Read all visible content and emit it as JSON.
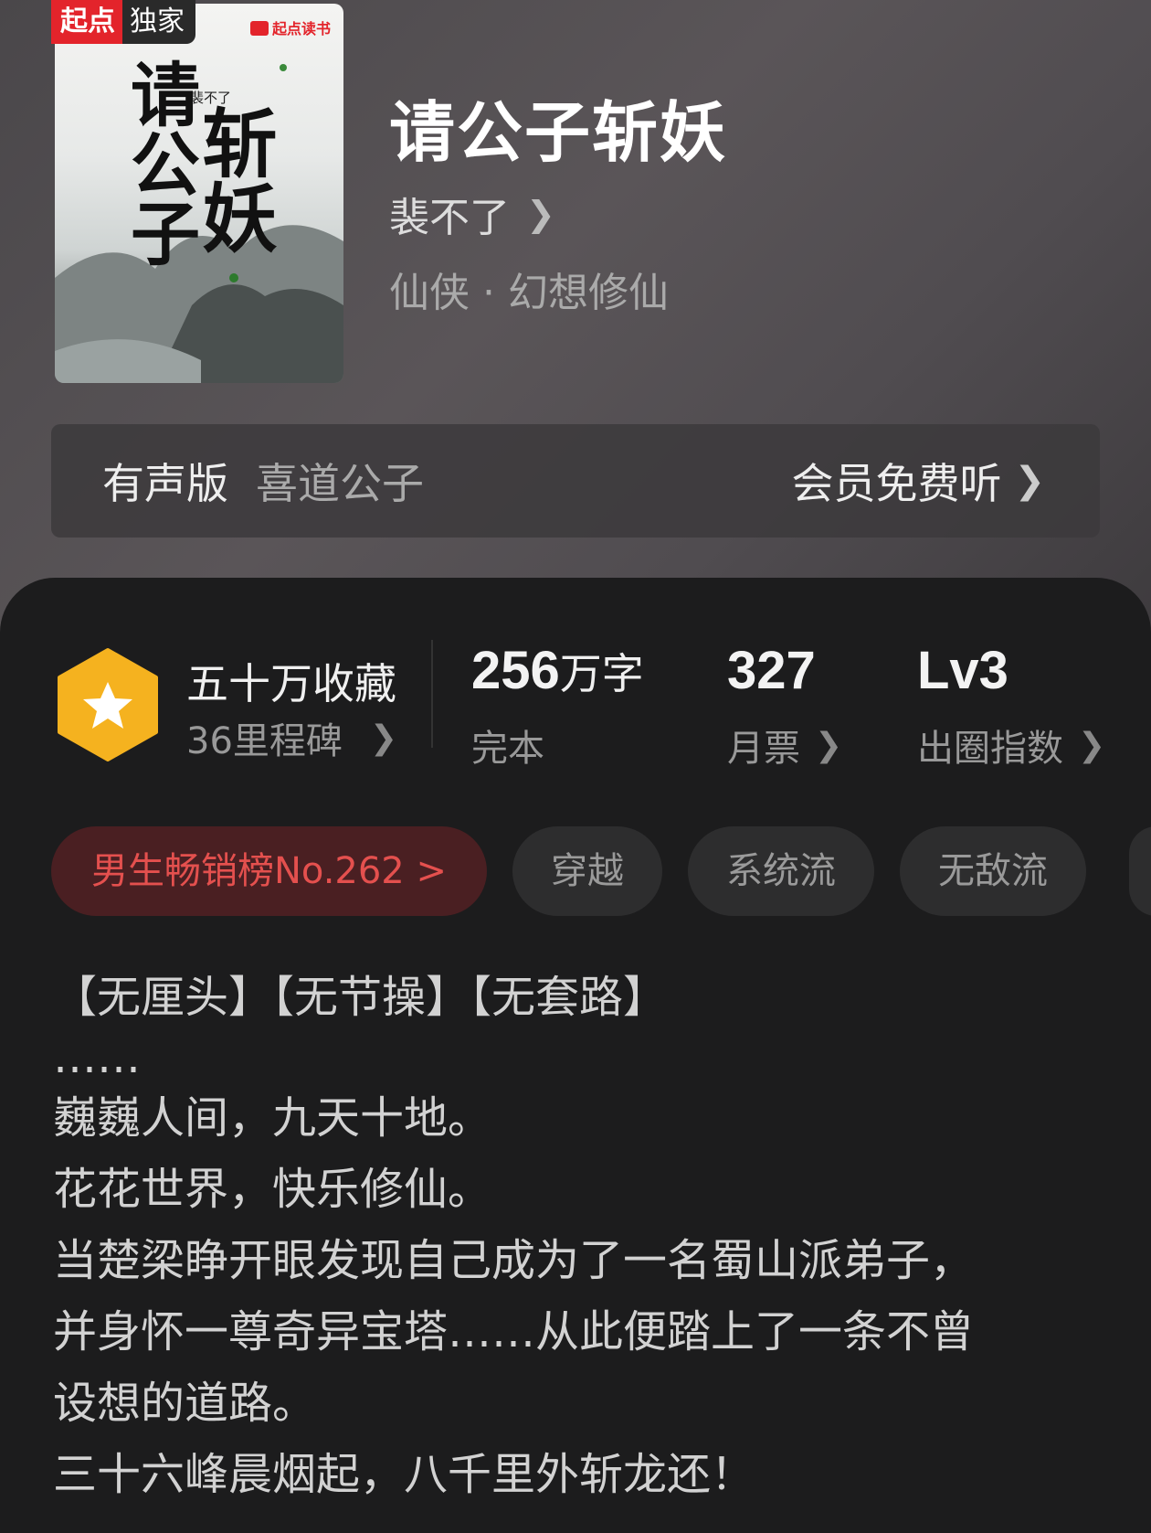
{
  "cover": {
    "badge_brand": "起点",
    "badge_label": "独家",
    "publisher": "起点读书",
    "title_part1": "请公子",
    "title_part2": "斩妖",
    "author_small": "裴不了"
  },
  "book": {
    "title": "请公子斩妖",
    "author": "裴不了",
    "genre": "仙侠 · 幻想修仙"
  },
  "audio": {
    "label": "有声版",
    "narrator": "喜道公子",
    "action": "会员免费听"
  },
  "stats": {
    "collect_title": "五十万收藏",
    "collect_sub": "36里程碑",
    "words_num": "256",
    "words_unit": "万字",
    "words_sub": "完本",
    "votes_num": "327",
    "votes_sub": "月票",
    "index_num": "Lv3",
    "index_sub": "出圈指数"
  },
  "tags": {
    "rank": "男生畅销榜No.262 >",
    "t1": "穿越",
    "t2": "系统流",
    "t3": "无敌流"
  },
  "synopsis": {
    "l1": "【无厘头】【无节操】【无套路】",
    "l2": "……",
    "l3": "巍巍人间，九天十地。",
    "l4": "花花世界，快乐修仙。",
    "l5": "当楚梁睁开眼发现自己成为了一名蜀山派弟子，",
    "l6": "并身怀一尊奇异宝塔……从此便踏上了一条不曾",
    "l7": "设想的道路。",
    "l8": "三十六峰晨烟起，八千里外斩龙还！"
  },
  "colors": {
    "accent_red": "#e3242b",
    "rank_text": "#e4504e",
    "hex_gold": "#f5b21f"
  }
}
